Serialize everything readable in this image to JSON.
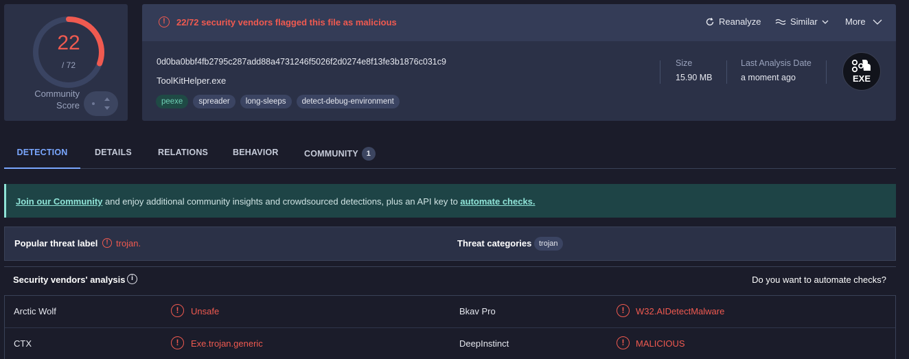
{
  "score": {
    "detections": "22",
    "total": "/ 72",
    "fraction": 0.3056,
    "community_label": "Community Score",
    "colors": {
      "malicious": "#f05a50",
      "ring": "#3a4462"
    }
  },
  "header": {
    "alert_icon": "alert-circle-icon",
    "alert_text": "22/72 security vendors flagged this file as malicious",
    "actions": {
      "reanalyze": "Reanalyze",
      "similar": "Similar",
      "more": "More"
    },
    "hash": "0d0ba0bbf4fb2795c287add88a4731246f5026f2d0274e8f13fe3b1876c031c9",
    "filename": "ToolKitHelper.exe",
    "tags": [
      "peexe",
      "spreader",
      "long-sleeps",
      "detect-debug-environment"
    ],
    "size_label": "Size",
    "size_value": "15.90 MB",
    "last_analysis_label": "Last Analysis Date",
    "last_analysis_value": "a moment ago",
    "file_type": "EXE"
  },
  "tabs": [
    {
      "label": "DETECTION",
      "active": true
    },
    {
      "label": "DETAILS"
    },
    {
      "label": "RELATIONS"
    },
    {
      "label": "BEHAVIOR"
    },
    {
      "label": "COMMUNITY",
      "badge": "1"
    }
  ],
  "banner": {
    "join_link": "Join our Community",
    "text": " and enjoy additional community insights and crowdsourced detections, plus an API key to ",
    "automate_link": "automate checks."
  },
  "threat": {
    "popular_label": "Popular threat label",
    "popular_value": "trojan.",
    "categories_label": "Threat categories",
    "categories": [
      "trojan"
    ]
  },
  "vendors": {
    "title": "Security vendors' analysis",
    "automate_question": "Do you want to automate checks?",
    "rows": [
      [
        {
          "name": "Arctic Wolf",
          "result": "Unsafe"
        },
        {
          "name": "Bkav Pro",
          "result": "W32.AIDetectMalware"
        }
      ],
      [
        {
          "name": "CTX",
          "result": "Exe.trojan.generic"
        },
        {
          "name": "DeepInstinct",
          "result": "MALICIOUS"
        }
      ]
    ]
  }
}
